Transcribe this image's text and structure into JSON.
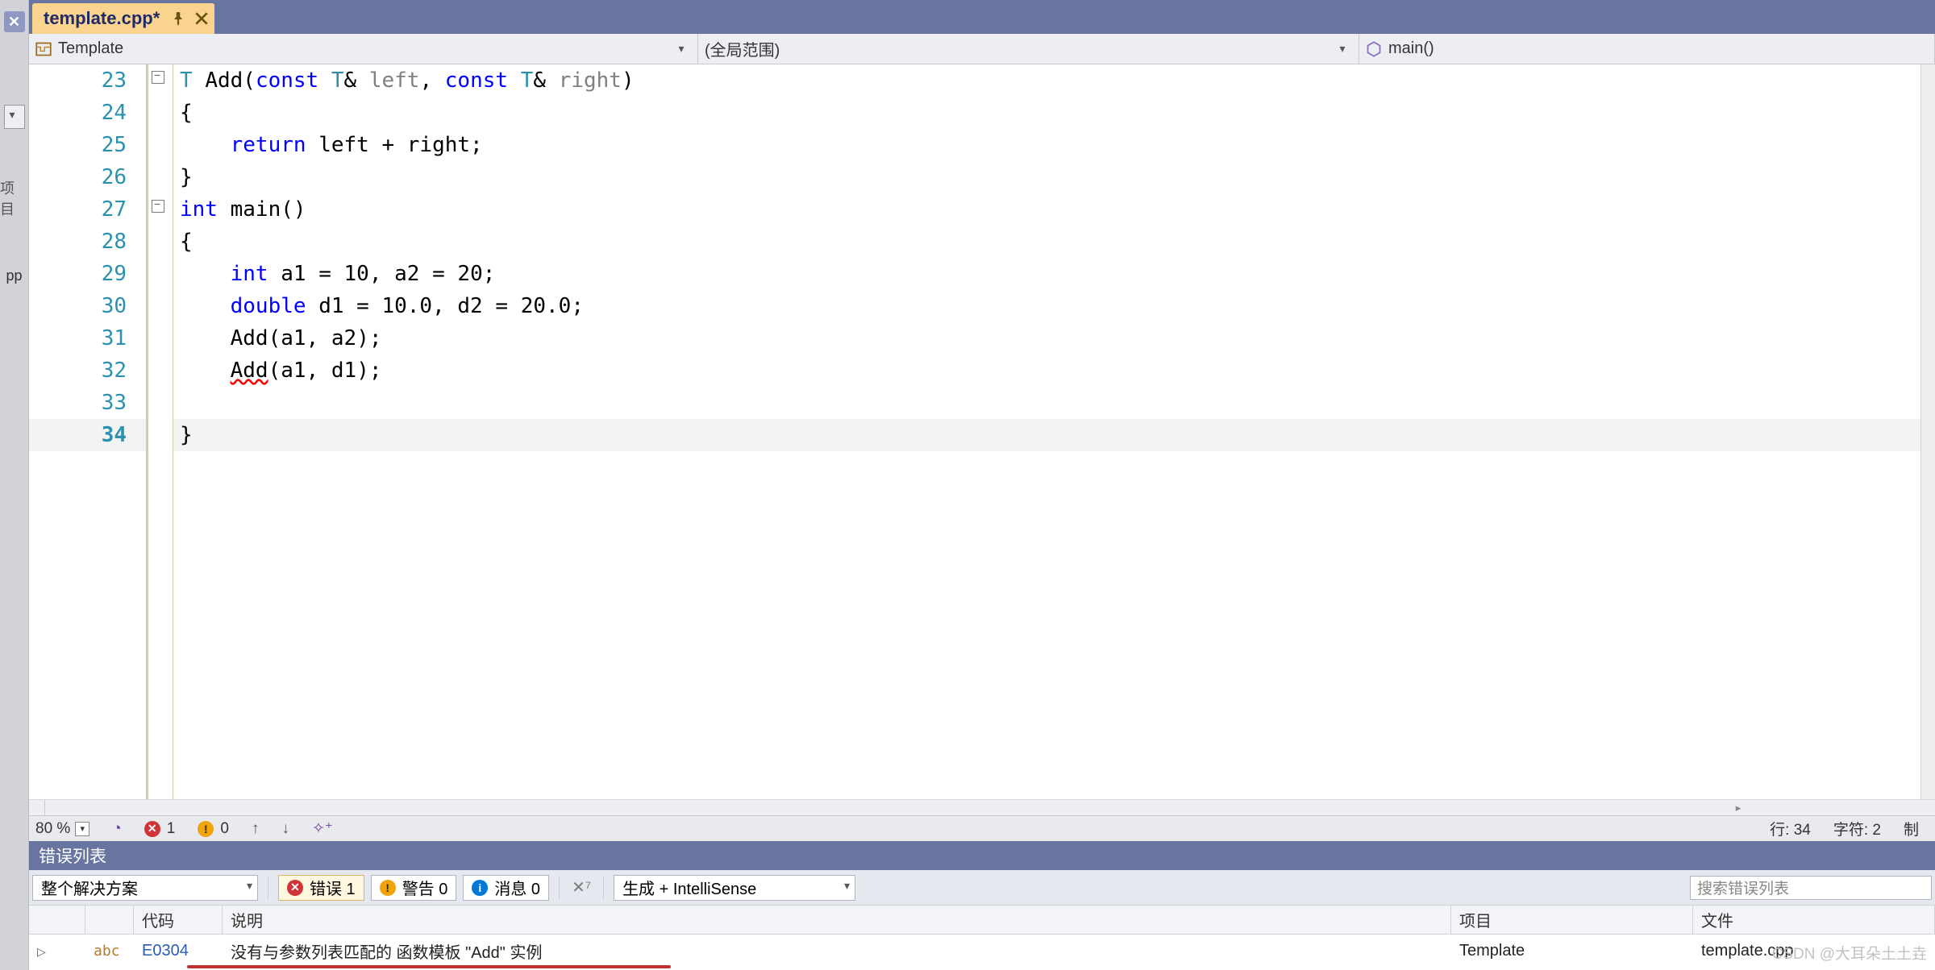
{
  "leftrail": {
    "label1": "项目",
    "label2": "pp"
  },
  "tab": {
    "title": "template.cpp*"
  },
  "scopes": {
    "s1": "Template",
    "s2": "(全局范围)",
    "s3": "main()"
  },
  "code": {
    "lines": [
      {
        "n": 23,
        "tokens": [
          [
            "tmpl",
            "T"
          ],
          [
            "op",
            " "
          ],
          [
            "",
            "Add"
          ],
          [
            "pnc",
            "("
          ],
          [
            "kw",
            "const"
          ],
          [
            "op",
            " "
          ],
          [
            "tmpl",
            "T"
          ],
          [
            "op",
            "& "
          ],
          [
            "gray",
            "left"
          ],
          [
            "pnc",
            ", "
          ],
          [
            "kw",
            "const"
          ],
          [
            "op",
            " "
          ],
          [
            "tmpl",
            "T"
          ],
          [
            "op",
            "& "
          ],
          [
            "gray",
            "right"
          ],
          [
            "pnc",
            ")"
          ]
        ]
      },
      {
        "n": 24,
        "tokens": [
          [
            "pnc",
            "{"
          ]
        ]
      },
      {
        "n": 25,
        "tokens": [
          [
            "",
            "    "
          ],
          [
            "kw",
            "return"
          ],
          [
            "op",
            " left "
          ],
          [
            "op",
            "+"
          ],
          [
            "op",
            " right"
          ],
          [
            "pnc",
            ";"
          ]
        ]
      },
      {
        "n": 26,
        "tokens": [
          [
            "pnc",
            "}"
          ]
        ]
      },
      {
        "n": 27,
        "tokens": [
          [
            "kw",
            "int"
          ],
          [
            "op",
            " "
          ],
          [
            "",
            "main"
          ],
          [
            "pnc",
            "()"
          ]
        ]
      },
      {
        "n": 28,
        "tokens": [
          [
            "pnc",
            "{"
          ]
        ]
      },
      {
        "n": 29,
        "tokens": [
          [
            "",
            "    "
          ],
          [
            "kw",
            "int"
          ],
          [
            "op",
            " a1 = "
          ],
          [
            "",
            "10"
          ],
          [
            "pnc",
            ", "
          ],
          [
            "op",
            "a2 = "
          ],
          [
            "",
            "20"
          ],
          [
            "pnc",
            ";"
          ]
        ]
      },
      {
        "n": 30,
        "tokens": [
          [
            "",
            "    "
          ],
          [
            "kw",
            "double"
          ],
          [
            "op",
            " d1 = "
          ],
          [
            "",
            "10.0"
          ],
          [
            "pnc",
            ", "
          ],
          [
            "op",
            "d2 = "
          ],
          [
            "",
            "20.0"
          ],
          [
            "pnc",
            ";"
          ]
        ]
      },
      {
        "n": 31,
        "tokens": [
          [
            "",
            "    "
          ],
          [
            "",
            "Add"
          ],
          [
            "pnc",
            "("
          ],
          [
            "op",
            "a1"
          ],
          [
            "pnc",
            ", "
          ],
          [
            "op",
            "a2"
          ],
          [
            "pnc",
            ")"
          ],
          [
            "pnc",
            ";"
          ]
        ]
      },
      {
        "n": 32,
        "tokens": [
          [
            "",
            "    "
          ],
          [
            "err",
            "Add"
          ],
          [
            "pnc",
            "("
          ],
          [
            "op",
            "a1"
          ],
          [
            "pnc",
            ", "
          ],
          [
            "op",
            "d1"
          ],
          [
            "pnc",
            ")"
          ],
          [
            "pnc",
            ";"
          ]
        ]
      },
      {
        "n": 33,
        "tokens": [
          [
            "",
            ""
          ]
        ]
      },
      {
        "n": 34,
        "cur": true,
        "tokens": [
          [
            "pnc",
            "}"
          ]
        ]
      }
    ]
  },
  "edstatus": {
    "zoom": "80 %",
    "errcount": "1",
    "warncount": "0",
    "line": "行: 34",
    "col": "字符: 2",
    "tail": "制"
  },
  "errorlist": {
    "title": "错误列表",
    "scope": "整个解决方案",
    "filters": {
      "errors": "错误 1",
      "warnings": "警告 0",
      "messages": "消息 0"
    },
    "source": "生成 + IntelliSense",
    "search_ph": "搜索错误列表",
    "headers": {
      "code": "代码",
      "desc": "说明",
      "proj": "项目",
      "file": "文件"
    },
    "row": {
      "abc": "abc",
      "code": "E0304",
      "desc": "没有与参数列表匹配的 函数模板 \"Add\" 实例",
      "proj": "Template",
      "file": "template.cpp"
    }
  },
  "watermark": "CSDN @大耳朵土土垚"
}
